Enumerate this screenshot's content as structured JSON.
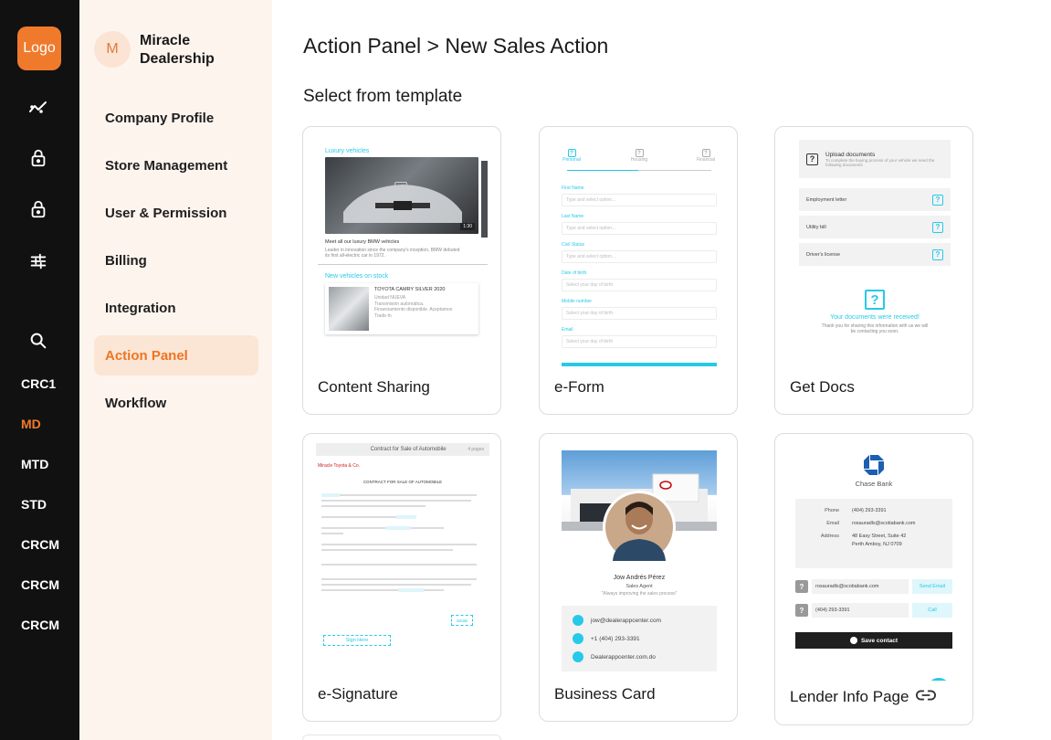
{
  "rail": {
    "logo_text": "Logo",
    "icons": [
      "analytics-icon",
      "lock-icon",
      "lock-icon",
      "sliders-icon",
      "search-icon"
    ],
    "labels": [
      "CRC1",
      "MD",
      "MTD",
      "STD",
      "CRCM",
      "CRCM",
      "CRCM"
    ],
    "active_label": "MD"
  },
  "org": {
    "avatar_letter": "M",
    "name": "Miracle Dealership"
  },
  "sidebar": {
    "items": [
      {
        "label": "Company Profile"
      },
      {
        "label": "Store Management"
      },
      {
        "label": "User & Permission"
      },
      {
        "label": "Billing"
      },
      {
        "label": "Integration"
      },
      {
        "label": "Action Panel"
      },
      {
        "label": "Workflow"
      }
    ],
    "active": "Action Panel"
  },
  "page": {
    "title": "Action Panel > New Sales Action",
    "subtitle": "Select from template"
  },
  "templates": [
    {
      "label": "Content Sharing"
    },
    {
      "label": "e-Form"
    },
    {
      "label": "Get Docs"
    },
    {
      "label": "e-Signature"
    },
    {
      "label": "Business Card"
    },
    {
      "label": "Lender Info Page"
    }
  ],
  "previews": {
    "content_sharing": {
      "section1": "Luxury vehicles",
      "duration": "1:30",
      "caption_title": "Meet all our luxury BMW vehicles",
      "caption_text": "Leader in innovation since the company's inception, BMW debuted its first all-electric car in 1972.",
      "section2": "New vehicles on stock",
      "car_title": "TOYOTA CAMRY SILVER 2020",
      "car_lines": [
        "Unidad NUEVA",
        "Transmisión automática.",
        "Financiamiento disponible. Aceptamos",
        "Trade-In"
      ]
    },
    "eform": {
      "steps": [
        "Personal",
        "Housing",
        "Financial"
      ],
      "fields": [
        {
          "label": "First Name",
          "placeholder": "Type and select option..."
        },
        {
          "label": "Last Name",
          "placeholder": "Type and select option..."
        },
        {
          "label": "Civil Status",
          "placeholder": "Type and select option..."
        },
        {
          "label": "Date of birth",
          "placeholder": "Select your day of birth"
        },
        {
          "label": "Mobile number",
          "placeholder": "Select your day of birth"
        },
        {
          "label": "Email",
          "placeholder": "Select your day of birth"
        }
      ]
    },
    "getdocs": {
      "header_title": "Upload documents",
      "header_text": "To complete the buying process of your vehicle we need the following documents",
      "docs": [
        "Employment letter",
        "Utility bill",
        "Driver's license"
      ],
      "received": "Your documents were received!",
      "thanks": "Thank you for sharing this information with us we will be contacting you soon."
    },
    "esignature": {
      "header": "Contract for Sale of Automobile",
      "pages": "4 pages",
      "company": "Miracle Toyota & Co.",
      "doc_title": "CONTRACT FOR SALE OF AUTOMOBILE",
      "sign_here": "Sign Here",
      "initials": "initials"
    },
    "business_card": {
      "name": "Jow Andrés Pérez",
      "role": "Sales Agent",
      "quote": "\"Always improving the sales process\"",
      "contacts": [
        "jow@dealerappcenter.com",
        "+1 (404) 293-3391",
        "Dealerappcenter.com.do"
      ]
    },
    "lender": {
      "bank": "Chase Bank",
      "rows": [
        {
          "key": "Phone",
          "value": "(404) 293-3391"
        },
        {
          "key": "Email",
          "value": "rosauradls@scotiabank.com"
        },
        {
          "key": "Address",
          "value": "48 Easy Street, Suite 42"
        },
        {
          "key": "",
          "value": "Perth Amboy, NJ 0709"
        }
      ],
      "actions": [
        {
          "value": "rosauradls@scotiabank.com",
          "button": "Send Email"
        },
        {
          "value": "(404) 293-3391",
          "button": "Call"
        }
      ],
      "save_contact": "Save contact"
    }
  },
  "colors": {
    "accent": "#f07a2c",
    "rail_bg": "#111111",
    "sidebar_bg": "#fdf4ee",
    "active_bg": "#fbe6d5",
    "cyan": "#27c9e8"
  }
}
